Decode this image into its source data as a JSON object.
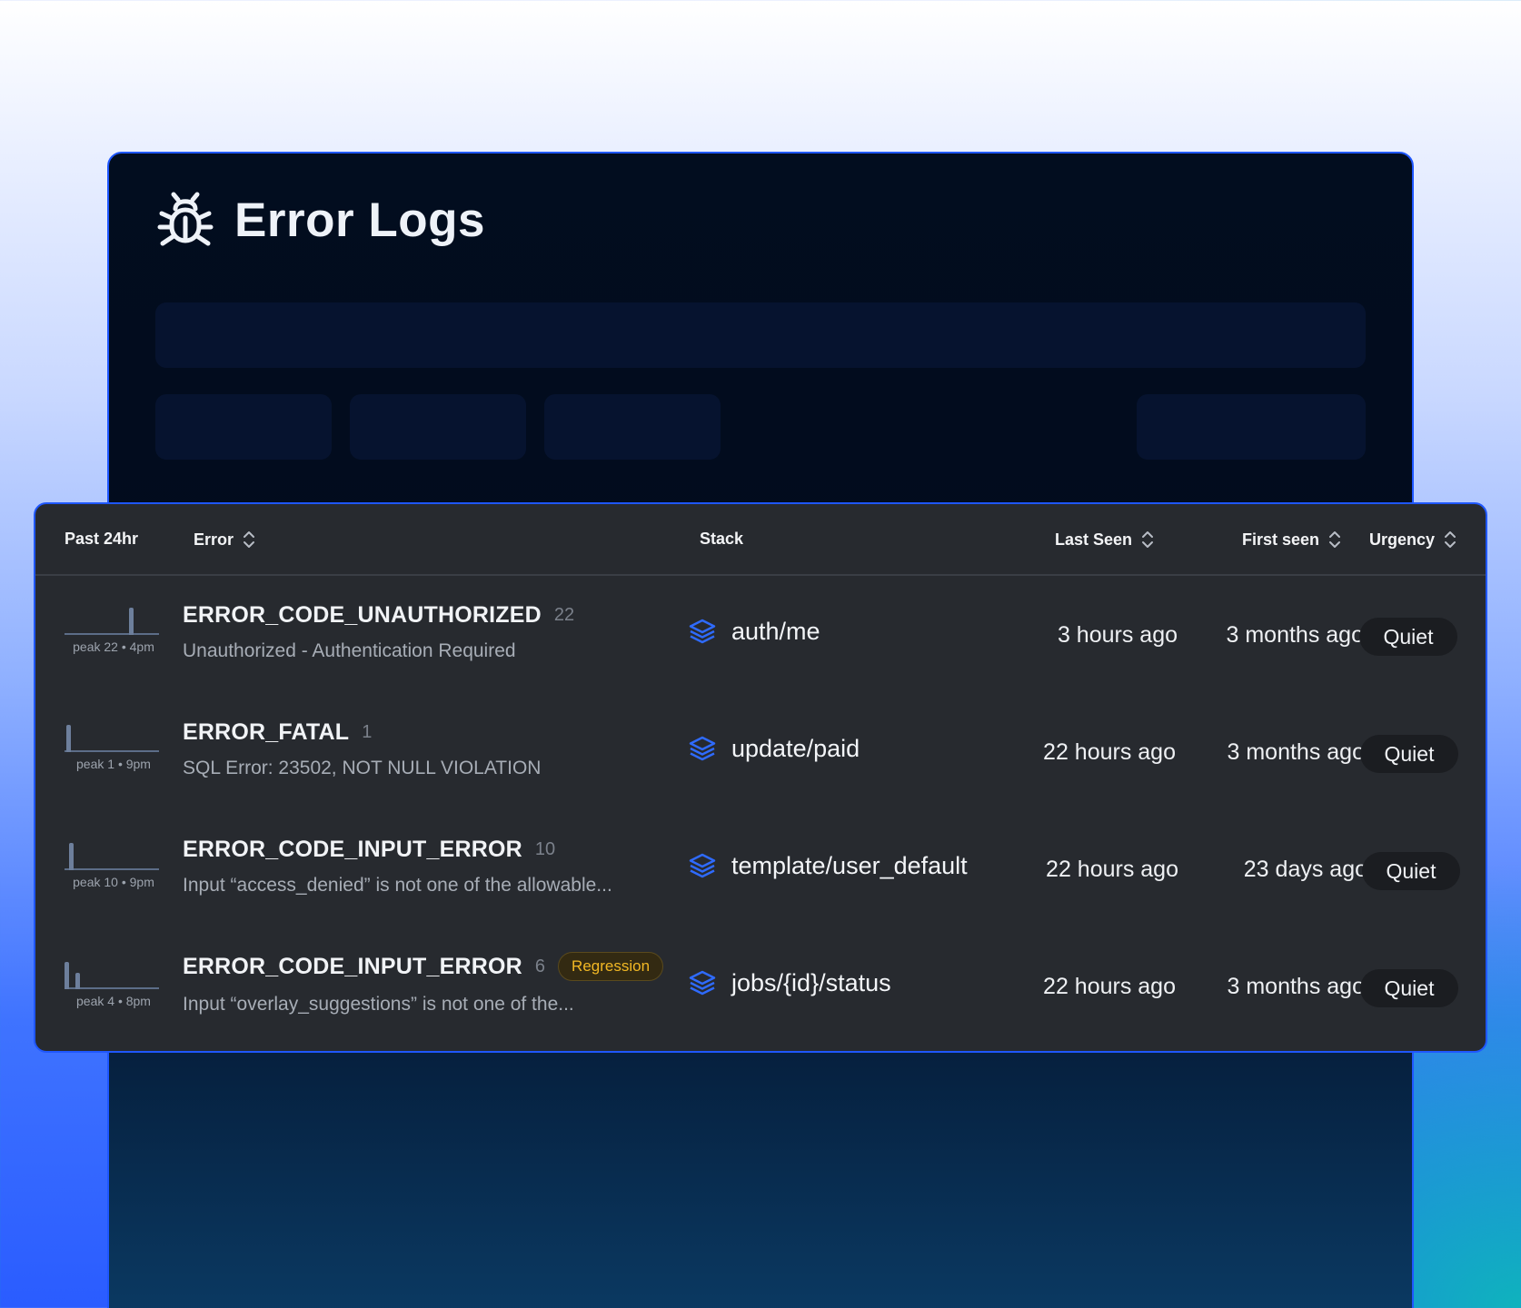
{
  "header": {
    "title": "Error Logs",
    "icon": "bug-icon"
  },
  "colors": {
    "accent": "#1f57ff",
    "panel_bg": "#020d1f",
    "table_bg": "#272a2f",
    "regression": "#f2b824"
  },
  "table": {
    "columns": {
      "past": "Past 24hr",
      "error": "Error",
      "stack": "Stack",
      "last_seen": "Last Seen",
      "first_seen": "First seen",
      "urgency": "Urgency"
    },
    "rows": [
      {
        "code": "ERROR_CODE_UNAUTHORIZED",
        "count": "22",
        "message": "Unauthorized - Authentication Required",
        "peak": "peak 22 • 4pm",
        "stack": "auth/me",
        "last_seen": "3 hours ago",
        "first_seen": "3 months ago",
        "urgency": "Quiet",
        "badge": ""
      },
      {
        "code": "ERROR_FATAL",
        "count": "1",
        "message": "SQL Error: 23502, NOT NULL VIOLATION",
        "peak": "peak 1 • 9pm",
        "stack": "update/paid",
        "last_seen": "22 hours ago",
        "first_seen": "3 months ago",
        "urgency": "Quiet",
        "badge": ""
      },
      {
        "code": "ERROR_CODE_INPUT_ERROR",
        "count": "10",
        "message": "Input “access_denied” is not one of the allowable...",
        "peak": "peak 10 • 9pm",
        "stack": "template/user_default",
        "last_seen": "22 hours ago",
        "first_seen": "23 days ago",
        "urgency": "Quiet",
        "badge": ""
      },
      {
        "code": "ERROR_CODE_INPUT_ERROR",
        "count": "6",
        "message": "Input “overlay_suggestions” is not one of the...",
        "peak": "peak 4 • 8pm",
        "stack": "jobs/{id}/status",
        "last_seen": "22 hours ago",
        "first_seen": "3 months ago",
        "urgency": "Quiet",
        "badge": "Regression"
      }
    ]
  }
}
